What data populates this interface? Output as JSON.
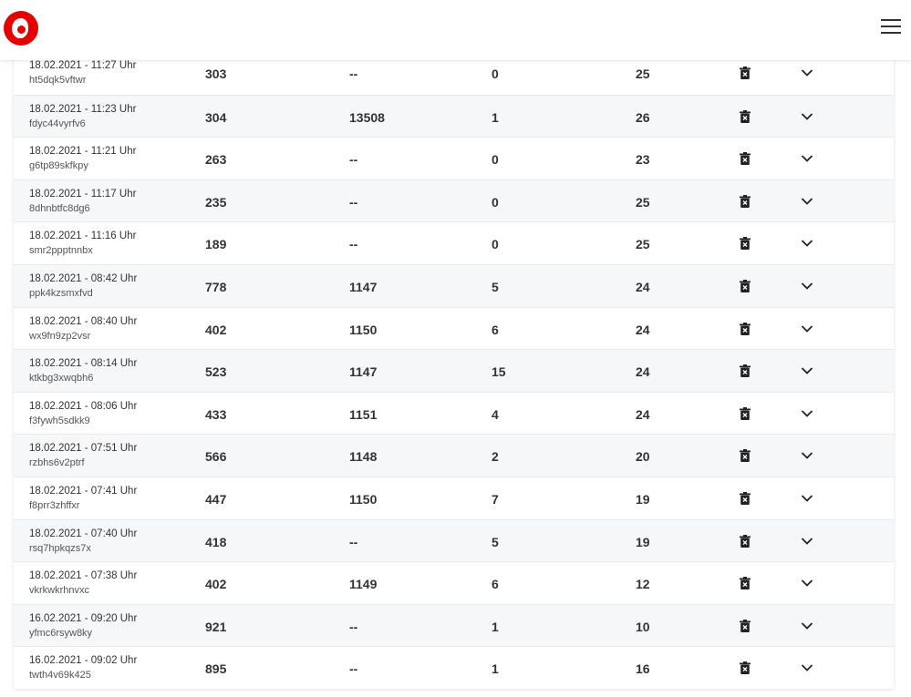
{
  "header": {
    "logo_icon": "vodafone-logo",
    "menu_icon": "hamburger-menu-icon",
    "brand_color": "#e60000"
  },
  "table": {
    "rows": [
      {
        "date": "18.02.2021 - 11:27 Uhr",
        "id": "ht5dqk5vftwr",
        "v1": "303",
        "v2": "--",
        "v3": "0",
        "v4": "25"
      },
      {
        "date": "18.02.2021 - 11:23 Uhr",
        "id": "fdyc44vyrfv6",
        "v1": "304",
        "v2": "13508",
        "v3": "1",
        "v4": "26"
      },
      {
        "date": "18.02.2021 - 11:21 Uhr",
        "id": "g6tp89skfkpy",
        "v1": "263",
        "v2": "--",
        "v3": "0",
        "v4": "23"
      },
      {
        "date": "18.02.2021 - 11:17 Uhr",
        "id": "8dhnbtfc8dg6",
        "v1": "235",
        "v2": "--",
        "v3": "0",
        "v4": "25"
      },
      {
        "date": "18.02.2021 - 11:16 Uhr",
        "id": "smr2ppptnnbx",
        "v1": "189",
        "v2": "--",
        "v3": "0",
        "v4": "25"
      },
      {
        "date": "18.02.2021 - 08:42 Uhr",
        "id": "ppk4kzsmxfvd",
        "v1": "778",
        "v2": "1147",
        "v3": "5",
        "v4": "24"
      },
      {
        "date": "18.02.2021 - 08:40 Uhr",
        "id": "wx9fn9zp2vsr",
        "v1": "402",
        "v2": "1150",
        "v3": "6",
        "v4": "24"
      },
      {
        "date": "18.02.2021 - 08:14 Uhr",
        "id": "ktkbg3xwqbh6",
        "v1": "523",
        "v2": "1147",
        "v3": "15",
        "v4": "24"
      },
      {
        "date": "18.02.2021 - 08:06 Uhr",
        "id": "f3fywh5sdkk9",
        "v1": "433",
        "v2": "1151",
        "v3": "4",
        "v4": "24"
      },
      {
        "date": "18.02.2021 - 07:51 Uhr",
        "id": "rzbhs6v2ptrf",
        "v1": "566",
        "v2": "1148",
        "v3": "2",
        "v4": "20"
      },
      {
        "date": "18.02.2021 - 07:41 Uhr",
        "id": "f8prr3zhffxr",
        "v1": "447",
        "v2": "1150",
        "v3": "7",
        "v4": "19"
      },
      {
        "date": "18.02.2021 - 07:40 Uhr",
        "id": "rsq7hpkqzs7x",
        "v1": "418",
        "v2": "--",
        "v3": "5",
        "v4": "19"
      },
      {
        "date": "18.02.2021 - 07:38 Uhr",
        "id": "vkrkwkrhnvxc",
        "v1": "402",
        "v2": "1149",
        "v3": "6",
        "v4": "12"
      },
      {
        "date": "16.02.2021 - 09:20 Uhr",
        "id": "yfmc6rsyw8ky",
        "v1": "921",
        "v2": "--",
        "v3": "1",
        "v4": "10"
      },
      {
        "date": "16.02.2021 - 09:02 Uhr",
        "id": "twth4v69k425",
        "v1": "895",
        "v2": "--",
        "v3": "1",
        "v4": "16"
      }
    ],
    "row_icons": {
      "delete": "trash-icon",
      "expand": "chevron-down-icon"
    }
  }
}
